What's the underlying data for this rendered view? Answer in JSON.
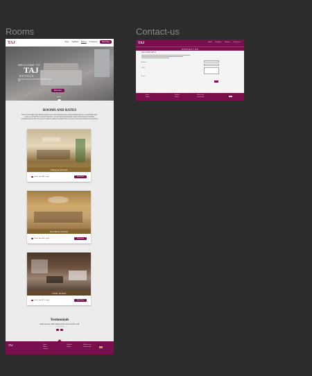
{
  "frames": {
    "rooms_label": "Rooms",
    "contact_label": "Contact-us"
  },
  "rooms": {
    "logo": "TAJ",
    "nav": [
      "Home",
      "Facilities",
      "Rooms",
      "Contact-us",
      "Book Now"
    ],
    "hero": {
      "welcome": "WELCOME TO",
      "brand": "TAJ",
      "hotels": "HOTELS",
      "subtitle": "Experience luxury and comfort in the heart of the city",
      "book_button": "Book Now",
      "scroll_label": "Scroll"
    },
    "section": {
      "title": "ROOMS AND RATES",
      "description": "Each of our bright, light-flooded rooms come with everything you could possibly want for a comfortable stay. And yes, comfort isn't our only objective, we also value good design, sleek contemporary furnishing complemented by the rich tones of nature's palette as visible from our rooms' sea-view windows and terraces."
    },
    "cards": [
      {
        "caption": "SINGLE ROOM",
        "info": "Rates from $60 / night",
        "button": "Book Now"
      },
      {
        "caption": "DOUBLE ROOM",
        "info": "Rates from $80 / night",
        "button": "Book Now"
      },
      {
        "caption": "TWIN ROOM",
        "info": "Rates from $70 / night",
        "button": "Book Now"
      }
    ],
    "testimonials": {
      "title": "Testimonials",
      "quote": "Great service, staff ! Enjoyed the room and the pool.",
      "author": "- Guest review"
    },
    "footer": {
      "brand": "TAJ",
      "col1": [
        "Home",
        "Rooms",
        "Contact"
      ],
      "col2": [
        "Facilities",
        "Gallery"
      ],
      "col3": [
        "Follow us on",
        "social media"
      ]
    }
  },
  "contact": {
    "logo": "TAJ",
    "nav": [
      "Home",
      "Facilities",
      "Rooms",
      "Contact-us"
    ],
    "title": "CONTACT US",
    "heading": "Get in touch with us",
    "address_label": "Address",
    "phone_label": "Phone",
    "email_label": "Email"
  },
  "colors": {
    "brand": "#7a0f4e",
    "canvas": "#2c2c2c",
    "accent_gold": "#c8a24a"
  }
}
